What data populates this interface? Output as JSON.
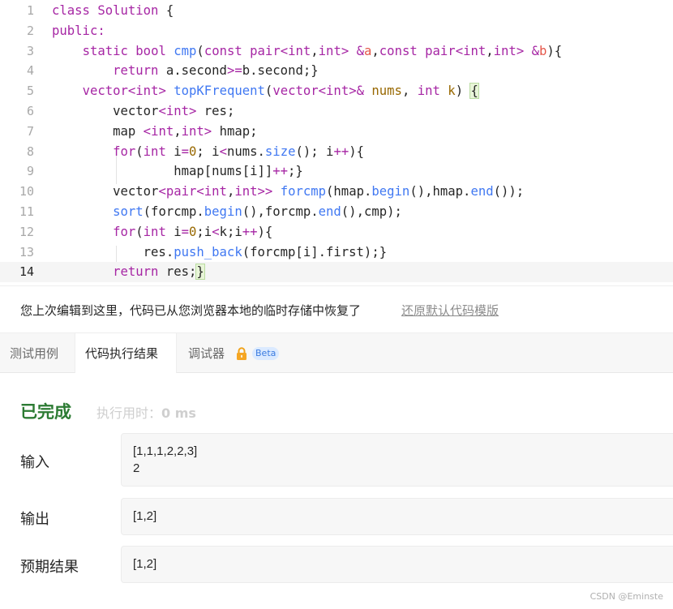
{
  "editor": {
    "line_numbers": [
      "1",
      "2",
      "3",
      "4",
      "5",
      "6",
      "7",
      "8",
      "9",
      "10",
      "11",
      "12",
      "13",
      "14"
    ],
    "active_line": 14
  },
  "notice": {
    "message": "您上次编辑到这里，代码已从您浏览器本地的临时存储中恢复了",
    "restore_link": "还原默认代码模版"
  },
  "tabs": {
    "testcase": "测试用例",
    "result": "代码执行结果",
    "debugger": "调试器",
    "beta": "Beta",
    "lock_icon": "lock-icon"
  },
  "result": {
    "status": "已完成",
    "exec_time_label": "执行用时：",
    "exec_time_value": "0 ms",
    "input_label": "输入",
    "input_line1": "[1,1,1,2,2,3]",
    "input_line2": "2",
    "output_label": "输出",
    "output_value": "[1,2]",
    "expected_label": "预期结果",
    "expected_value": "[1,2]"
  },
  "watermark": "CSDN @Eminste",
  "colors": {
    "keyword": "#a626a4",
    "function": "#4078f2",
    "number": "#986801",
    "status_green": "#2c7b33"
  }
}
